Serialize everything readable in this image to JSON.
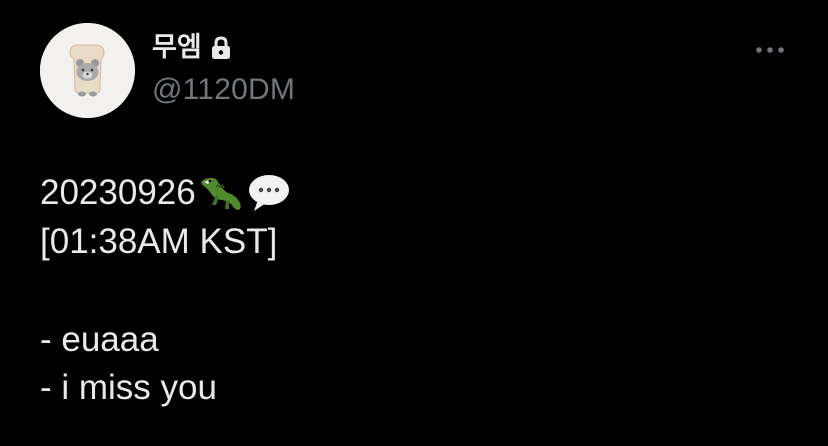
{
  "user": {
    "display_name": "무엠",
    "handle": "@1120DM",
    "protected": true,
    "avatar_icon": "bear-in-toast-avatar"
  },
  "menu": {
    "more_icon": "more-horizontal-icon"
  },
  "tweet": {
    "date_text": "20230926",
    "emojis": [
      "crocodile-emoji",
      "speech-balloon-emoji"
    ],
    "time_text": "[01:38AM KST]",
    "lines": [
      "- euaaa",
      "- i miss you"
    ]
  },
  "colors": {
    "background": "#000000",
    "text_primary": "#e7e9ea",
    "text_secondary": "#71767b"
  }
}
